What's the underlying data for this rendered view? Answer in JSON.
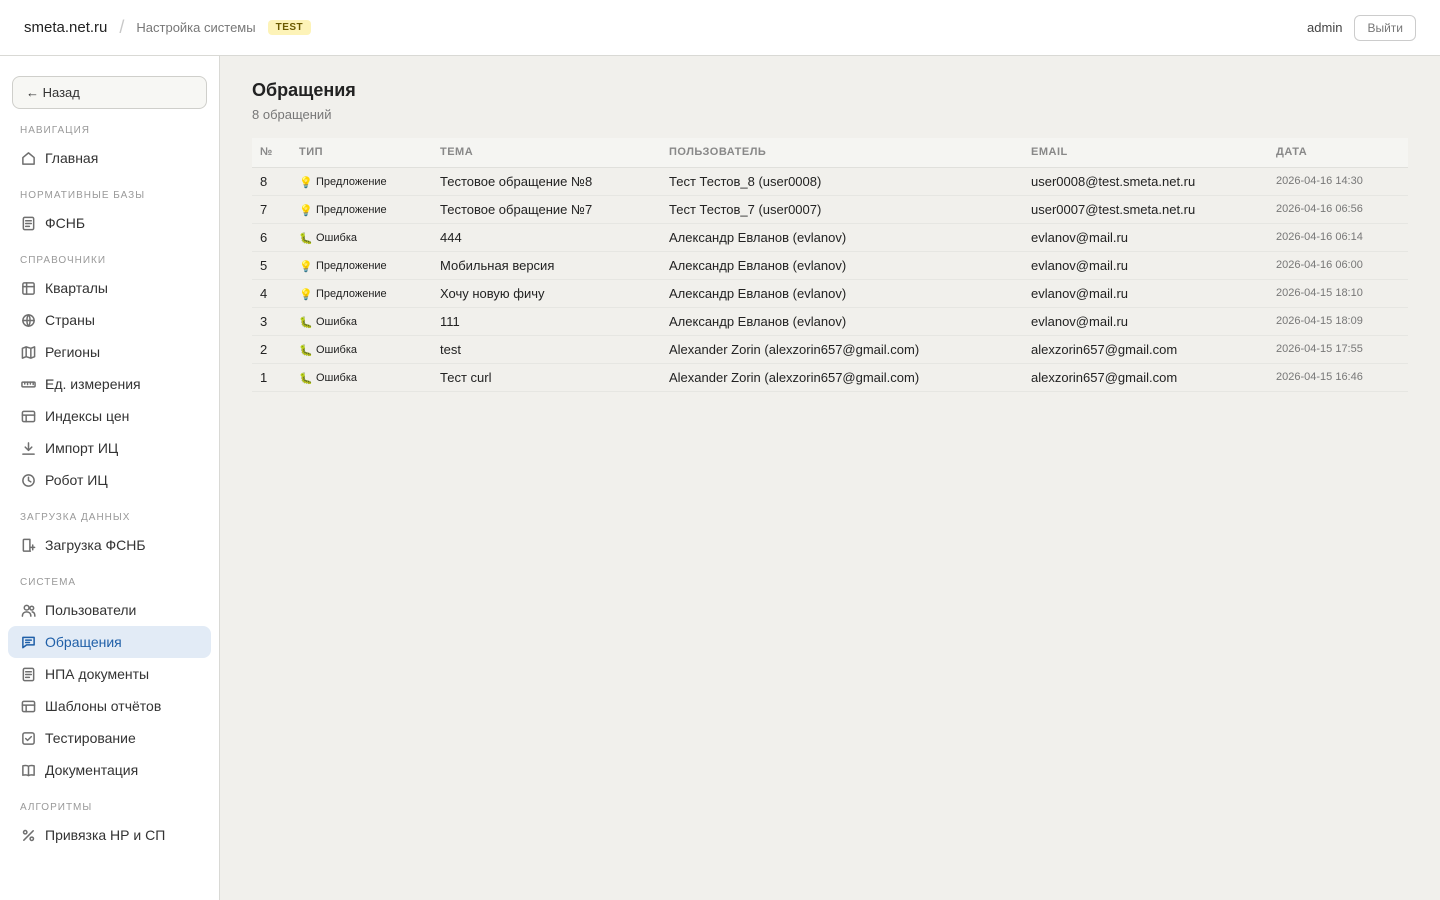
{
  "header": {
    "brand": "smeta.net.ru",
    "separator": "/",
    "breadcrumb": "Настройка системы",
    "env_badge": "TEST",
    "user": "admin",
    "logout_label": "Выйти"
  },
  "sidebar": {
    "back_label": "← Назад",
    "sections": [
      {
        "title": "НАВИГАЦИЯ",
        "items": [
          {
            "label": "Главная",
            "icon": "home-icon"
          }
        ]
      },
      {
        "title": "НОРМАТИВНЫЕ БАЗЫ",
        "items": [
          {
            "label": "ФСНБ",
            "icon": "document-icon"
          }
        ]
      },
      {
        "title": "СПРАВОЧНИКИ",
        "items": [
          {
            "label": "Кварталы",
            "icon": "grid-icon"
          },
          {
            "label": "Страны",
            "icon": "globe-icon"
          },
          {
            "label": "Регионы",
            "icon": "map-icon"
          },
          {
            "label": "Ед. измерения",
            "icon": "ruler-icon"
          },
          {
            "label": "Индексы цен",
            "icon": "table-icon"
          },
          {
            "label": "Импорт ИЦ",
            "icon": "download-icon"
          },
          {
            "label": "Робот ИЦ",
            "icon": "clock-icon"
          }
        ]
      },
      {
        "title": "ЗАГРУЗКА ДАННЫХ",
        "items": [
          {
            "label": "Загрузка ФСНБ",
            "icon": "file-upload-icon"
          }
        ]
      },
      {
        "title": "СИСТЕМА",
        "items": [
          {
            "label": "Пользователи",
            "icon": "users-icon"
          },
          {
            "label": "Обращения",
            "icon": "message-icon",
            "active": true
          },
          {
            "label": "НПА документы",
            "icon": "document-icon"
          },
          {
            "label": "Шаблоны отчётов",
            "icon": "table-icon"
          },
          {
            "label": "Тестирование",
            "icon": "check-square-icon"
          },
          {
            "label": "Документация",
            "icon": "book-icon"
          }
        ]
      },
      {
        "title": "АЛГОРИТМЫ",
        "items": [
          {
            "label": "Привязка НР и СП",
            "icon": "percent-icon"
          }
        ]
      }
    ]
  },
  "main": {
    "title": "Обращения",
    "subtitle": "8 обращений",
    "columns": [
      "№",
      "ТИП",
      "ТЕМА",
      "ПОЛЬЗОВАТЕЛЬ",
      "EMAIL",
      "ДАТА"
    ],
    "rows": [
      {
        "id": "8",
        "type": "Предложение",
        "type_icon": "💡",
        "subject": "Тестовое обращение №8",
        "user": "Тест Тестов_8 (user0008)",
        "email": "user0008@test.smeta.net.ru",
        "date": "2026-04-16 14:30"
      },
      {
        "id": "7",
        "type": "Предложение",
        "type_icon": "💡",
        "subject": "Тестовое обращение №7",
        "user": "Тест Тестов_7 (user0007)",
        "email": "user0007@test.smeta.net.ru",
        "date": "2026-04-16 06:56"
      },
      {
        "id": "6",
        "type": "Ошибка",
        "type_icon": "🐛",
        "subject": "444",
        "user": "Александр Евланов (evlanov)",
        "email": "evlanov@mail.ru",
        "date": "2026-04-16 06:14"
      },
      {
        "id": "5",
        "type": "Предложение",
        "type_icon": "💡",
        "subject": "Мобильная версия",
        "user": "Александр Евланов (evlanov)",
        "email": "evlanov@mail.ru",
        "date": "2026-04-16 06:00"
      },
      {
        "id": "4",
        "type": "Предложение",
        "type_icon": "💡",
        "subject": "Хочу новую фичу",
        "user": "Александр Евланов (evlanov)",
        "email": "evlanov@mail.ru",
        "date": "2026-04-15 18:10"
      },
      {
        "id": "3",
        "type": "Ошибка",
        "type_icon": "🐛",
        "subject": "111",
        "user": "Александр Евланов (evlanov)",
        "email": "evlanov@mail.ru",
        "date": "2026-04-15 18:09"
      },
      {
        "id": "2",
        "type": "Ошибка",
        "type_icon": "🐛",
        "subject": "test",
        "user": "Alexander Zorin (alexzorin657@gmail.com)",
        "email": "alexzorin657@gmail.com",
        "date": "2026-04-15 17:55"
      },
      {
        "id": "1",
        "type": "Ошибка",
        "type_icon": "🐛",
        "subject": "Тест curl",
        "user": "Alexander Zorin (alexzorin657@gmail.com)",
        "email": "alexzorin657@gmail.com",
        "date": "2026-04-15 16:46"
      }
    ]
  },
  "colors": {
    "accent": "#1f5fa8",
    "active_bg": "#e2ebf6",
    "badge_bg": "#fdf3b8"
  }
}
